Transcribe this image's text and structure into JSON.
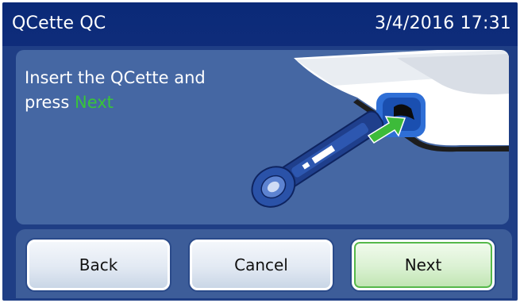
{
  "window": {
    "title": "QCette QC",
    "datetime": "3/4/2016 17:31"
  },
  "instruction": {
    "line1": "Insert the QCette and",
    "line2_prefix": "press ",
    "line2_highlight": "Next"
  },
  "buttons": {
    "back": "Back",
    "cancel": "Cancel",
    "next": "Next"
  },
  "colors": {
    "titlebar": "#0f2c7a",
    "panel": "#4567a3",
    "highlight": "#39c43a",
    "next_button_tint": "#daf1d2"
  },
  "icons": {
    "illustration": "qcette-insert-illustration",
    "arrow": "green-arrow-icon"
  }
}
